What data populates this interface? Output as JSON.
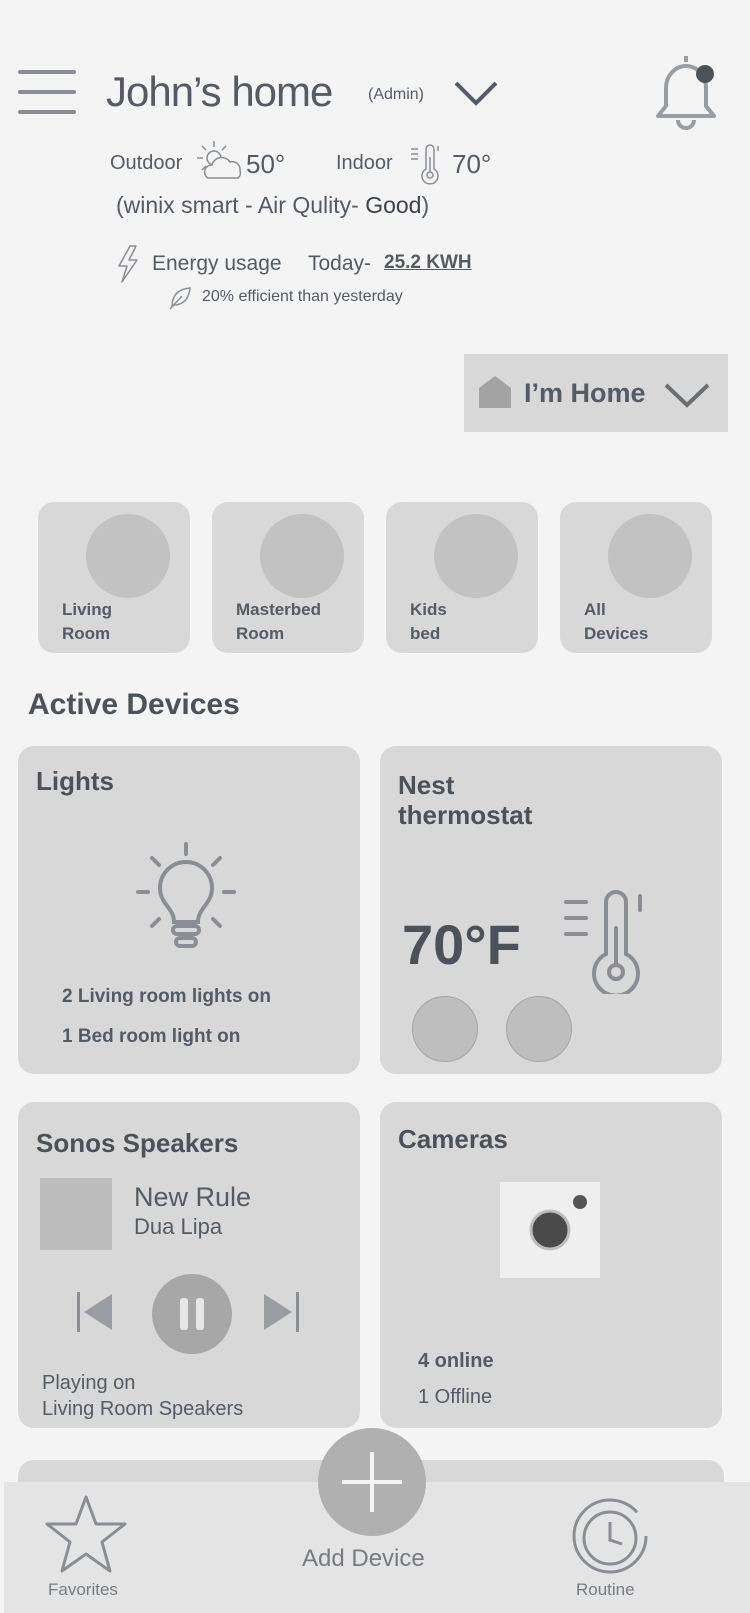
{
  "header": {
    "title": "John’s home",
    "role": "(Admin)"
  },
  "weather": {
    "outdoor_label": "Outdoor",
    "outdoor_temp": "50°",
    "indoor_label": "Indoor",
    "indoor_temp": "70°",
    "air_quality_prefix": "(winix smart - Air Qulity- ",
    "air_quality_value": "Good",
    "air_quality_suffix": ")"
  },
  "energy": {
    "label": "Energy usage",
    "today_label": "Today-",
    "today_value": "25.2 KWH",
    "efficiency": "20% efficient than yesterday"
  },
  "mode": {
    "label": "I’m Home"
  },
  "rooms": [
    {
      "label": "Living\nRoom"
    },
    {
      "label": "Masterbed\nRoom"
    },
    {
      "label": "Kids\nbed"
    },
    {
      "label": "All\nDevices"
    }
  ],
  "active_devices": {
    "title": "Active Devices",
    "lights": {
      "title": "Lights",
      "line1": "2 Living room lights on",
      "line2": "1 Bed room light on"
    },
    "thermostat": {
      "title_line1": "Nest",
      "title_line2": "thermostat",
      "temp": "70°F"
    },
    "speakers": {
      "title": "Sonos Speakers",
      "song": "New Rule",
      "artist": "Dua Lipa",
      "playing": "Playing on\nLiving Room Speakers"
    },
    "cameras": {
      "title": "Cameras",
      "online": "4 online",
      "offline": "1 Offline"
    }
  },
  "nav": {
    "favorites": "Favorites",
    "add_device": "Add Device",
    "routine": "Routine"
  },
  "colors": {
    "background": "#f4f4f4",
    "card": "#d8d8d8",
    "text": "#555b62",
    "icon": "#8a8e93"
  }
}
